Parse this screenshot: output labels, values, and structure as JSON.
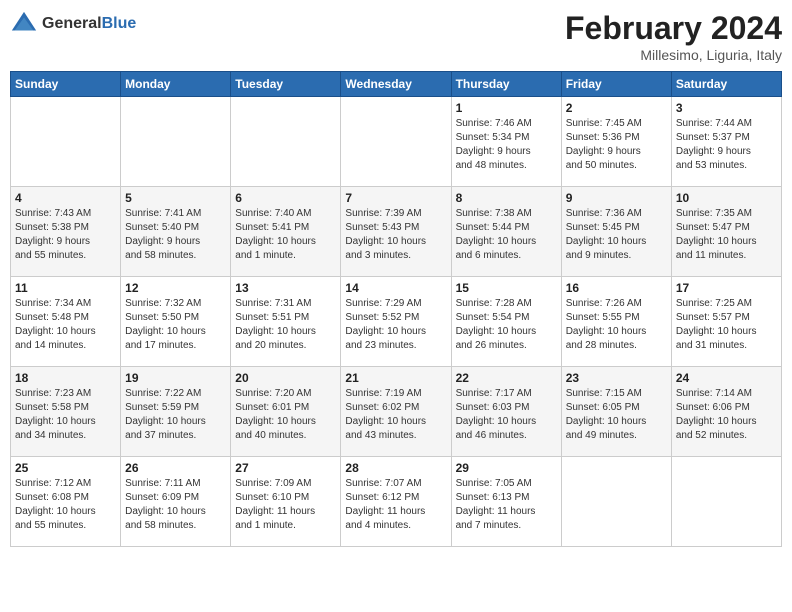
{
  "header": {
    "logo": {
      "general": "General",
      "blue": "Blue"
    },
    "title": "February 2024",
    "location": "Millesimo, Liguria, Italy"
  },
  "days_of_week": [
    "Sunday",
    "Monday",
    "Tuesday",
    "Wednesday",
    "Thursday",
    "Friday",
    "Saturday"
  ],
  "weeks": [
    [
      {
        "num": "",
        "info": ""
      },
      {
        "num": "",
        "info": ""
      },
      {
        "num": "",
        "info": ""
      },
      {
        "num": "",
        "info": ""
      },
      {
        "num": "1",
        "info": "Sunrise: 7:46 AM\nSunset: 5:34 PM\nDaylight: 9 hours\nand 48 minutes."
      },
      {
        "num": "2",
        "info": "Sunrise: 7:45 AM\nSunset: 5:36 PM\nDaylight: 9 hours\nand 50 minutes."
      },
      {
        "num": "3",
        "info": "Sunrise: 7:44 AM\nSunset: 5:37 PM\nDaylight: 9 hours\nand 53 minutes."
      }
    ],
    [
      {
        "num": "4",
        "info": "Sunrise: 7:43 AM\nSunset: 5:38 PM\nDaylight: 9 hours\nand 55 minutes."
      },
      {
        "num": "5",
        "info": "Sunrise: 7:41 AM\nSunset: 5:40 PM\nDaylight: 9 hours\nand 58 minutes."
      },
      {
        "num": "6",
        "info": "Sunrise: 7:40 AM\nSunset: 5:41 PM\nDaylight: 10 hours\nand 1 minute."
      },
      {
        "num": "7",
        "info": "Sunrise: 7:39 AM\nSunset: 5:43 PM\nDaylight: 10 hours\nand 3 minutes."
      },
      {
        "num": "8",
        "info": "Sunrise: 7:38 AM\nSunset: 5:44 PM\nDaylight: 10 hours\nand 6 minutes."
      },
      {
        "num": "9",
        "info": "Sunrise: 7:36 AM\nSunset: 5:45 PM\nDaylight: 10 hours\nand 9 minutes."
      },
      {
        "num": "10",
        "info": "Sunrise: 7:35 AM\nSunset: 5:47 PM\nDaylight: 10 hours\nand 11 minutes."
      }
    ],
    [
      {
        "num": "11",
        "info": "Sunrise: 7:34 AM\nSunset: 5:48 PM\nDaylight: 10 hours\nand 14 minutes."
      },
      {
        "num": "12",
        "info": "Sunrise: 7:32 AM\nSunset: 5:50 PM\nDaylight: 10 hours\nand 17 minutes."
      },
      {
        "num": "13",
        "info": "Sunrise: 7:31 AM\nSunset: 5:51 PM\nDaylight: 10 hours\nand 20 minutes."
      },
      {
        "num": "14",
        "info": "Sunrise: 7:29 AM\nSunset: 5:52 PM\nDaylight: 10 hours\nand 23 minutes."
      },
      {
        "num": "15",
        "info": "Sunrise: 7:28 AM\nSunset: 5:54 PM\nDaylight: 10 hours\nand 26 minutes."
      },
      {
        "num": "16",
        "info": "Sunrise: 7:26 AM\nSunset: 5:55 PM\nDaylight: 10 hours\nand 28 minutes."
      },
      {
        "num": "17",
        "info": "Sunrise: 7:25 AM\nSunset: 5:57 PM\nDaylight: 10 hours\nand 31 minutes."
      }
    ],
    [
      {
        "num": "18",
        "info": "Sunrise: 7:23 AM\nSunset: 5:58 PM\nDaylight: 10 hours\nand 34 minutes."
      },
      {
        "num": "19",
        "info": "Sunrise: 7:22 AM\nSunset: 5:59 PM\nDaylight: 10 hours\nand 37 minutes."
      },
      {
        "num": "20",
        "info": "Sunrise: 7:20 AM\nSunset: 6:01 PM\nDaylight: 10 hours\nand 40 minutes."
      },
      {
        "num": "21",
        "info": "Sunrise: 7:19 AM\nSunset: 6:02 PM\nDaylight: 10 hours\nand 43 minutes."
      },
      {
        "num": "22",
        "info": "Sunrise: 7:17 AM\nSunset: 6:03 PM\nDaylight: 10 hours\nand 46 minutes."
      },
      {
        "num": "23",
        "info": "Sunrise: 7:15 AM\nSunset: 6:05 PM\nDaylight: 10 hours\nand 49 minutes."
      },
      {
        "num": "24",
        "info": "Sunrise: 7:14 AM\nSunset: 6:06 PM\nDaylight: 10 hours\nand 52 minutes."
      }
    ],
    [
      {
        "num": "25",
        "info": "Sunrise: 7:12 AM\nSunset: 6:08 PM\nDaylight: 10 hours\nand 55 minutes."
      },
      {
        "num": "26",
        "info": "Sunrise: 7:11 AM\nSunset: 6:09 PM\nDaylight: 10 hours\nand 58 minutes."
      },
      {
        "num": "27",
        "info": "Sunrise: 7:09 AM\nSunset: 6:10 PM\nDaylight: 11 hours\nand 1 minute."
      },
      {
        "num": "28",
        "info": "Sunrise: 7:07 AM\nSunset: 6:12 PM\nDaylight: 11 hours\nand 4 minutes."
      },
      {
        "num": "29",
        "info": "Sunrise: 7:05 AM\nSunset: 6:13 PM\nDaylight: 11 hours\nand 7 minutes."
      },
      {
        "num": "",
        "info": ""
      },
      {
        "num": "",
        "info": ""
      }
    ]
  ]
}
